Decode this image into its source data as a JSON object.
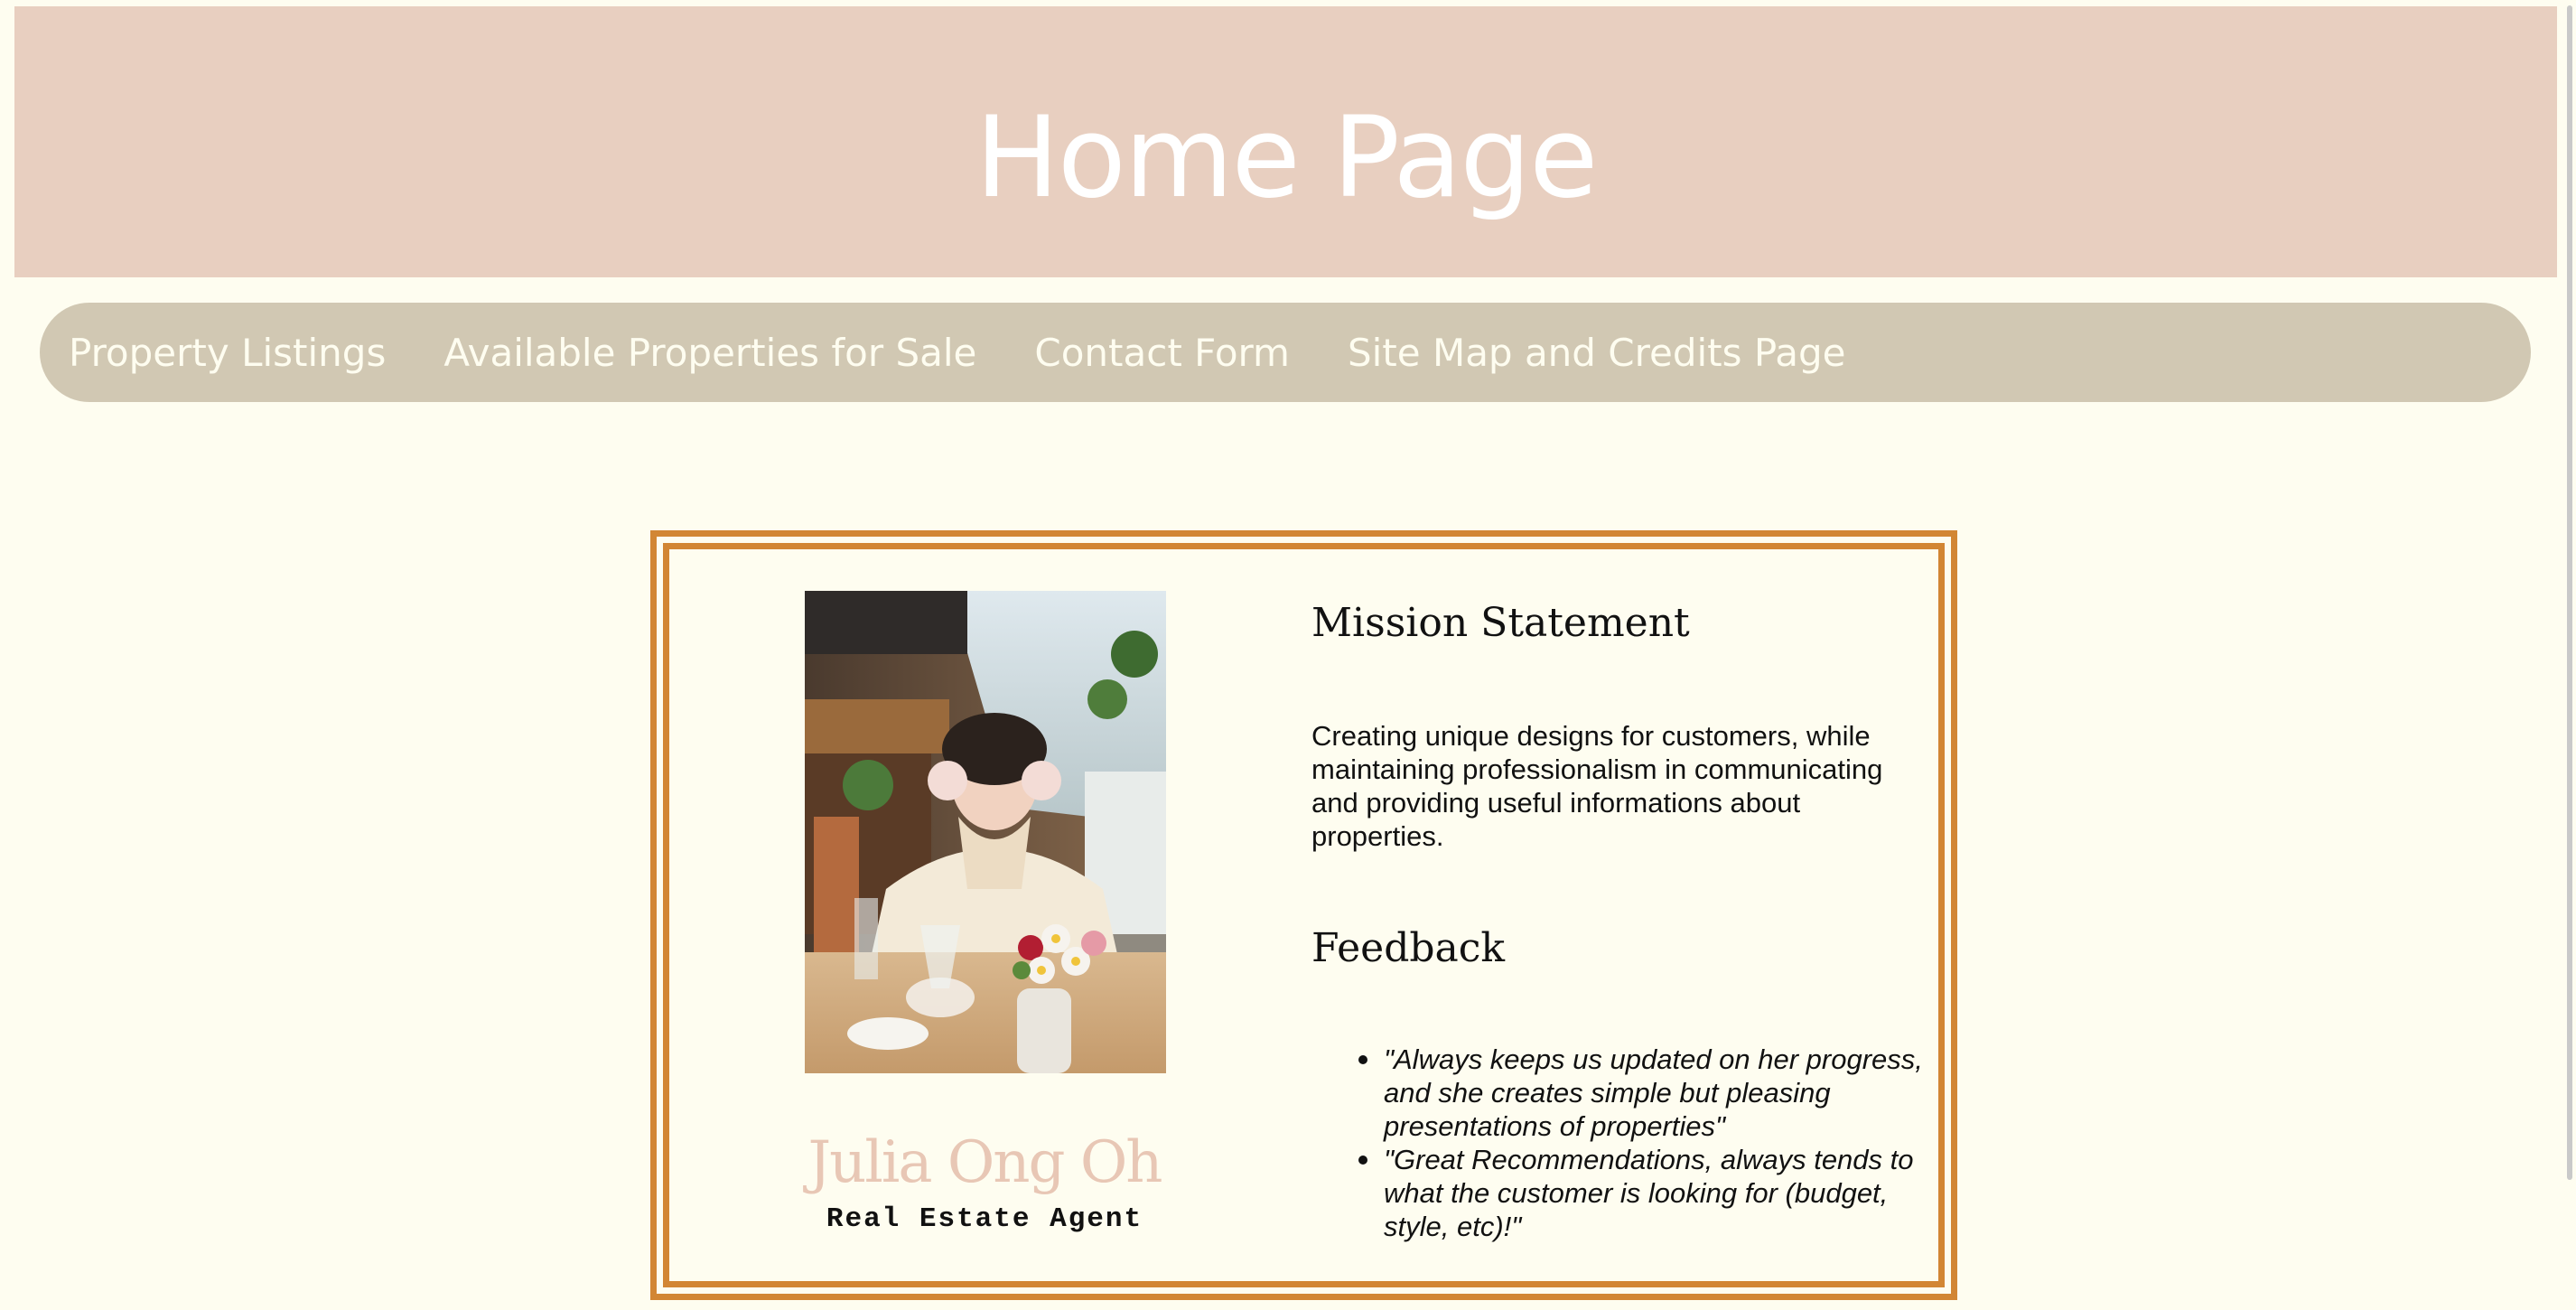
{
  "header": {
    "title": "Home Page"
  },
  "nav": {
    "items": [
      {
        "label": "Property Listings"
      },
      {
        "label": "Available Properties for Sale"
      },
      {
        "label": "Contact Form"
      },
      {
        "label": "Site Map and Credits Page"
      }
    ]
  },
  "agent": {
    "name": "Julia Ong Oh",
    "title": "Real Estate Agent"
  },
  "mission": {
    "heading": "Mission Statement",
    "text": "Creating unique designs for customers, while maintaining professionalism in communicating and providing useful informations about properties."
  },
  "feedback": {
    "heading": "Feedback",
    "items": [
      "\"Always keeps us updated on her progress, and she creates simple but pleasing presentations of properties\"",
      "\"Great Recommendations, always tends to what the customer is looking for (budget, style, etc)!\""
    ]
  },
  "colors": {
    "header_bg": "#e8cfc0",
    "nav_bg": "#d1c8b3",
    "page_bg": "#fefdf0",
    "card_border": "#d28634",
    "agent_name": "#e8c7b5"
  }
}
